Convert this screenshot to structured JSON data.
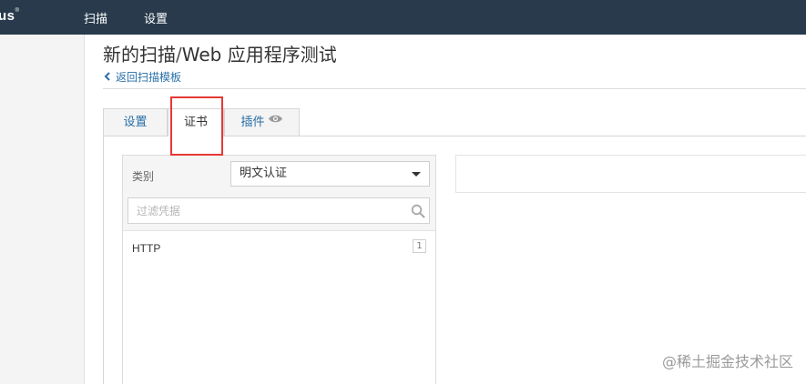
{
  "app": {
    "logo": "us",
    "logo_mark": "®"
  },
  "nav": {
    "scans": "扫描",
    "settings": "设置"
  },
  "page": {
    "title_main": "新的扫描",
    "title_sep": "/",
    "title_rest": "Web 应用程序测试",
    "back_link": "返回扫描模板"
  },
  "tabs": [
    {
      "label": "设置"
    },
    {
      "label": "证书",
      "active": true
    },
    {
      "label": "插件",
      "icon": "eye-icon"
    }
  ],
  "credentials": {
    "category_label": "类别",
    "category_value": "明文认证",
    "filter_placeholder": "过滤凭据",
    "items": [
      {
        "label": "HTTP",
        "count": "1"
      }
    ]
  },
  "watermark": "@稀土掘金技术社区",
  "colors": {
    "topbar": "#283a4c",
    "link": "#2a6fa8",
    "highlight": "#e53935"
  }
}
